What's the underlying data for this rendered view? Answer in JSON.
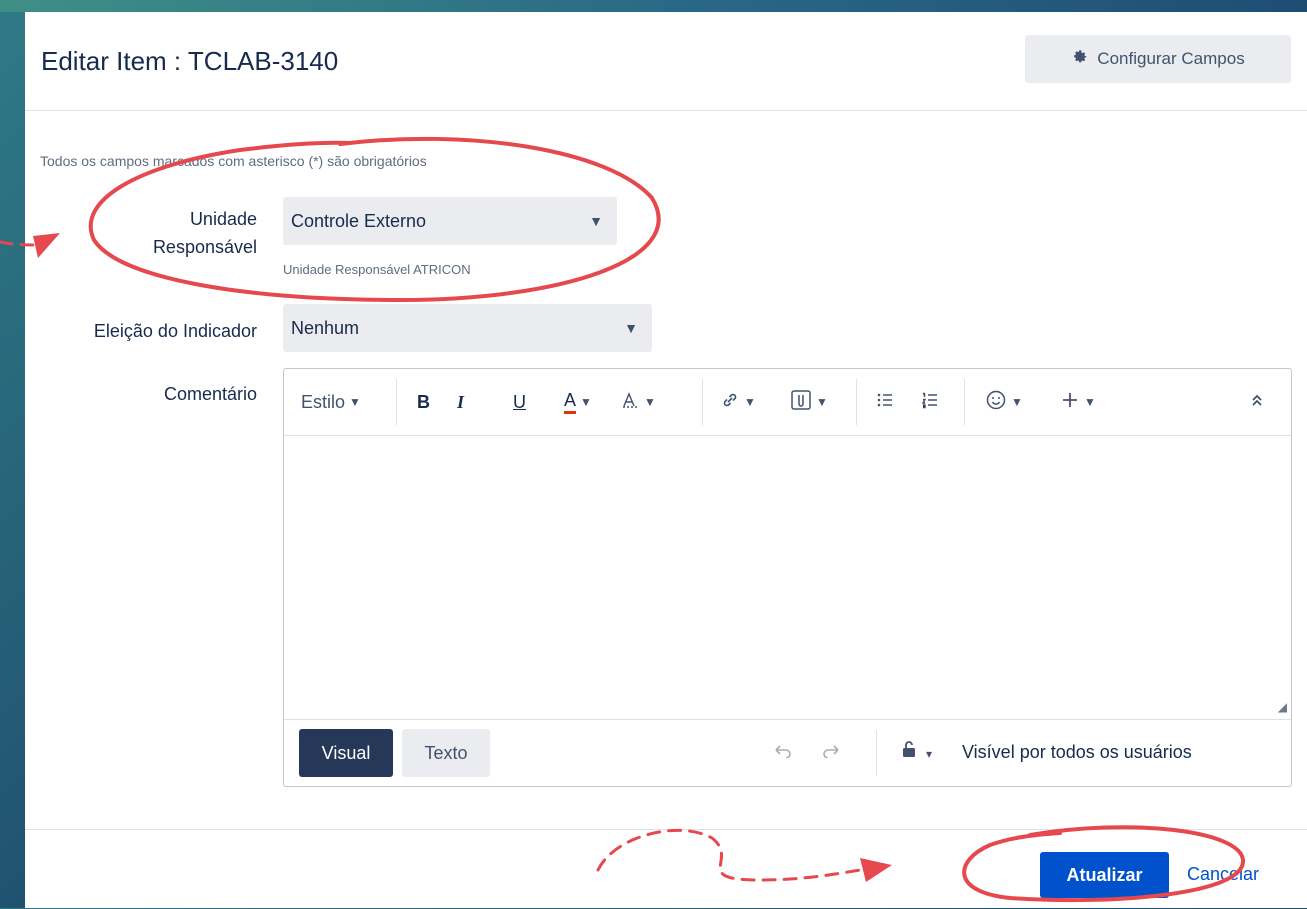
{
  "dialog": {
    "title": "Editar Item : TCLAB-3140",
    "config_button": "Configurar Campos",
    "required_note": "Todos os campos marcados com asterisco (*) são obrigatórios"
  },
  "fields": {
    "unidade": {
      "label_line1": "Unidade",
      "label_line2": "Responsável",
      "value": "Controle Externo",
      "description": "Unidade Responsável ATRICON"
    },
    "eleicao": {
      "label": "Eleição do Indicador",
      "value": "Nenhum"
    },
    "comentario": {
      "label": "Comentário"
    }
  },
  "editor": {
    "style_label": "Estilo",
    "bold": "B",
    "italic": "I",
    "underline": "U",
    "text_color": "A",
    "mode_visual": "Visual",
    "mode_text": "Texto",
    "visibility": "Visível por todos os usuários"
  },
  "footer": {
    "update_button": "Atualizar",
    "cancel_link": "Cancelar"
  },
  "colors": {
    "primary": "#0052cc",
    "annotation": "#e5484d",
    "visual_active": "#253858"
  }
}
